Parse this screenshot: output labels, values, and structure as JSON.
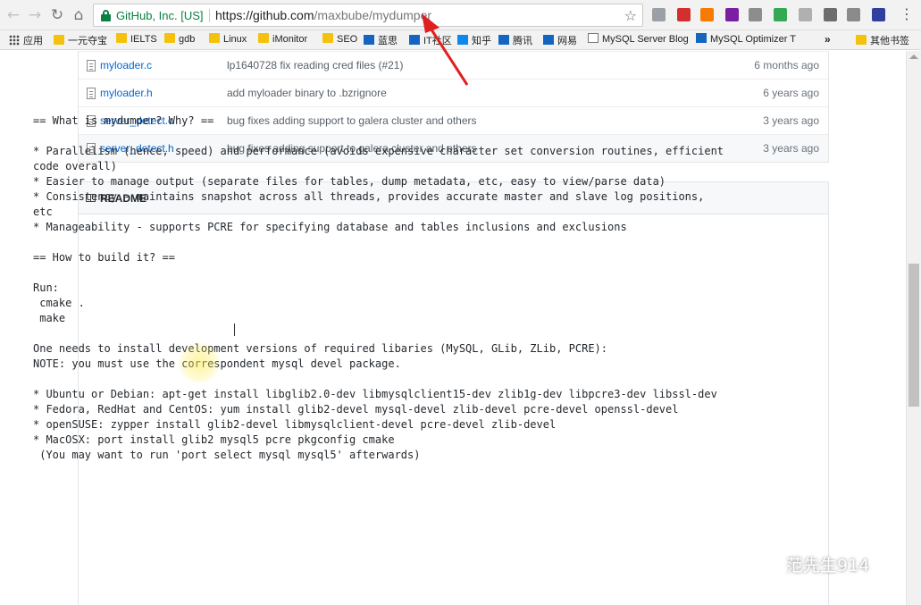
{
  "browser": {
    "origin": "GitHub, Inc. [US]",
    "url_host": "https://github.com",
    "url_path": "/maxbube/mydumper",
    "menu_glyph": "⋮",
    "star_glyph": "☆",
    "extension_colors": [
      "#9aa0a6",
      "#d32f2f",
      "#f57c00",
      "#7b1fa2",
      "#8d8d8d",
      "#34a853",
      "#b0b0b0",
      "#6d6d6d",
      "#8a8a8a",
      "#303f9f"
    ]
  },
  "bookmarks": [
    {
      "label": "应用",
      "icon": "apps-icon"
    },
    {
      "label": "一元夺宝",
      "icon": "folder-icon"
    },
    {
      "label": "IELTS",
      "icon": "folder-icon"
    },
    {
      "label": "gdb",
      "icon": "folder-icon"
    },
    {
      "label": "Linux",
      "icon": "folder-icon"
    },
    {
      "label": "iMonitor",
      "icon": "folder-icon"
    },
    {
      "label": "SEO",
      "icon": "folder-icon"
    },
    {
      "label": "蓝思",
      "icon": "site-icon"
    },
    {
      "label": "IT社区",
      "icon": "site-icon"
    },
    {
      "label": "知乎",
      "icon": "zhihu-icon"
    },
    {
      "label": "腾讯",
      "icon": "site-icon"
    },
    {
      "label": "网易",
      "icon": "site-icon"
    },
    {
      "label": "MySQL Server Blog",
      "icon": "page-icon"
    },
    {
      "label": "MySQL Optimizer T",
      "icon": "site-icon"
    },
    {
      "label": "»",
      "icon": ""
    },
    {
      "label": "其他书签",
      "icon": "folder-icon"
    }
  ],
  "files": [
    {
      "name": "myloader.c",
      "message": "lp1640728 fix reading cred files (#21)",
      "age": "6 months ago"
    },
    {
      "name": "myloader.h",
      "message": "add myloader binary to .bzrignore",
      "age": "6 years ago"
    },
    {
      "name": "server_detect.c",
      "message": "bug fixes adding support to galera cluster and others",
      "age": "3 years ago"
    },
    {
      "name": "server_detect.h",
      "message": "bug fixes adding support to galera cluster and others",
      "age": "3 years ago"
    }
  ],
  "readme": {
    "title": "README",
    "lines": [
      "== What is mydumper? Why? ==",
      "",
      "* Parallelism (hence, speed) and performance (avoids expensive character set conversion routines, efficient",
      "code overall)",
      "* Easier to manage output (separate files for tables, dump metadata, etc, easy to view/parse data)",
      "* Consistency - maintains snapshot across all threads, provides accurate master and slave log positions,",
      "etc",
      "* Manageability - supports PCRE for specifying database and tables inclusions and exclusions",
      "",
      "== How to build it? ==",
      "",
      "Run:",
      " cmake .",
      " make",
      "",
      "One needs to install development versions of required libaries (MySQL, GLib, ZLib, PCRE):",
      "NOTE: you must use the correspondent mysql devel package.",
      "",
      "* Ubuntu or Debian: apt-get install libglib2.0-dev libmysqlclient15-dev zlib1g-dev libpcre3-dev libssl-dev",
      "* Fedora, RedHat and CentOS: yum install glib2-devel mysql-devel zlib-devel pcre-devel openssl-devel",
      "* openSUSE: zypper install glib2-devel libmysqlclient-devel pcre-devel zlib-devel",
      "* MacOSX: port install glib2 mysql5 pcre pkgconfig cmake",
      " (You may want to run 'port select mysql mysql5' afterwards)"
    ]
  },
  "watermark": {
    "text": "范先生914"
  },
  "colors": {
    "link": "#0366d6",
    "secure": "#0b8043",
    "annotation_arrow": "#e02020"
  }
}
